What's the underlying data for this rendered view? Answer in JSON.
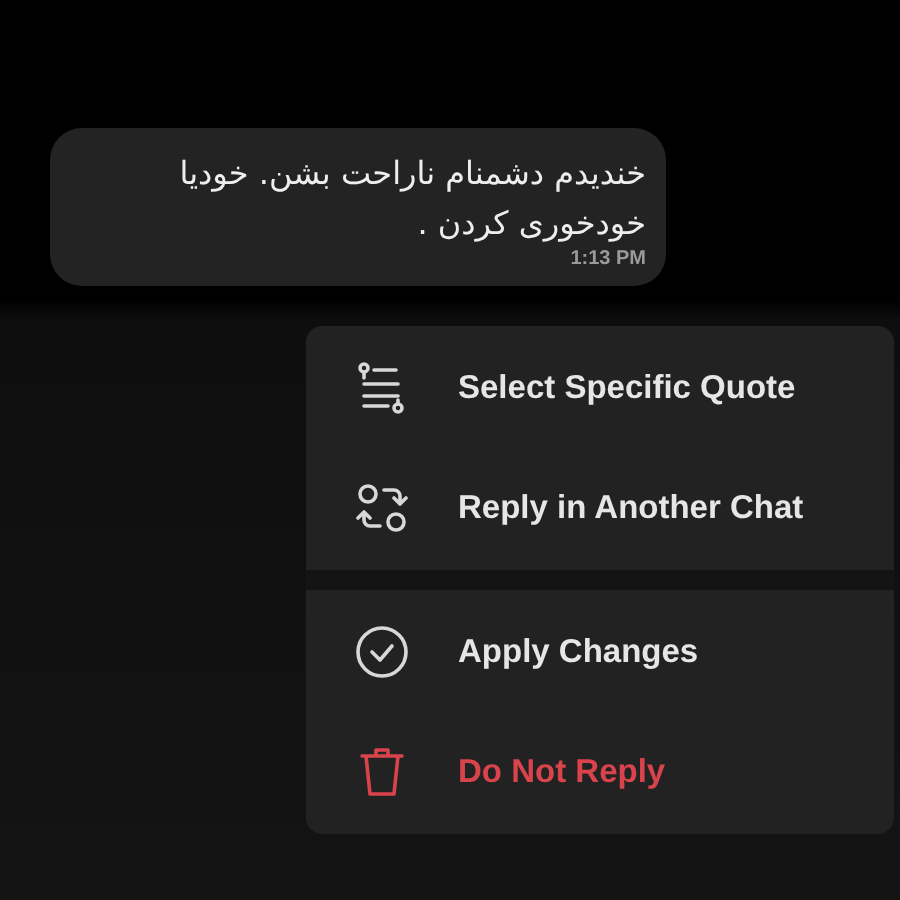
{
  "message": {
    "text": "خندیدم دشمنام ناراحت بشن. خودیا خودخوری کردن .",
    "time": "1:13 PM"
  },
  "menu": {
    "groups": [
      {
        "items": [
          {
            "kind": "quote",
            "label": "Select Specific Quote"
          },
          {
            "kind": "forward",
            "label": "Reply in Another Chat"
          }
        ]
      },
      {
        "items": [
          {
            "kind": "confirm",
            "label": "Apply Changes"
          },
          {
            "kind": "delete",
            "label": "Do Not Reply"
          }
        ]
      }
    ]
  }
}
